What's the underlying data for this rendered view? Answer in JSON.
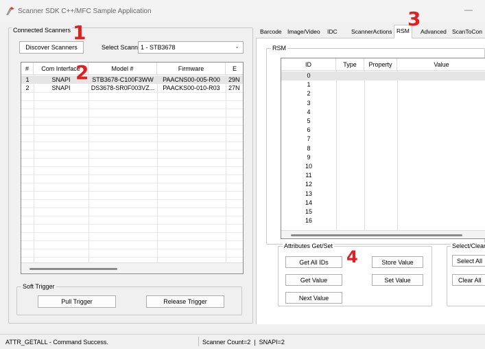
{
  "window": {
    "title": "Scanner SDK C++/MFC Sample Application",
    "minimize_glyph": "—"
  },
  "connected": {
    "group_title": "Connected Scanners",
    "discover_label": "Discover Scanners",
    "select_label": "Select Scanner",
    "select_value": "1 - STB3678",
    "columns": [
      "#",
      "Com Interface",
      "Model #",
      "Firmware",
      "E"
    ],
    "rows": [
      [
        "1",
        "SNAPI",
        "STB3678-C100F3WW",
        "PAACNS00-005-R00",
        "29N"
      ],
      [
        "2",
        "SNAPI",
        "DS3678-SR0F003VZ...",
        "PAACKS00-010-R03",
        "27N"
      ]
    ]
  },
  "soft_trigger": {
    "title": "Soft Trigger",
    "pull_label": "Pull Trigger",
    "release_label": "Release Trigger"
  },
  "tabs": [
    "Barcode",
    "Image/Video",
    "IDC",
    "ScannerActions",
    "RSM",
    "Advanced",
    "ScanToCon"
  ],
  "active_tab": "RSM",
  "rsm": {
    "group_title": "RSM",
    "columns": [
      "ID",
      "Type",
      "Property",
      "Value"
    ],
    "ids": [
      "0",
      "1",
      "2",
      "3",
      "4",
      "5",
      "6",
      "7",
      "8",
      "9",
      "10",
      "11",
      "12",
      "13",
      "14",
      "15",
      "16"
    ]
  },
  "attributes": {
    "title": "Attributes Get/Set",
    "get_all_ids": "Get All IDs",
    "get_value": "Get Value",
    "next_value": "Next Value",
    "store_value": "Store Value",
    "set_value": "Set Value"
  },
  "select_clear": {
    "title": "Select/Clear",
    "select_all": "Select All",
    "clear_all": "Clear All"
  },
  "status": {
    "message": "ATTR_GETALL - Command Success.",
    "counts": "Scanner Count=2  |  SNAPI=2"
  },
  "annotations": [
    "1",
    "2",
    "3",
    "4"
  ],
  "colors": {
    "annotation": "#e02020",
    "selected_row": "#e5e5e5"
  }
}
